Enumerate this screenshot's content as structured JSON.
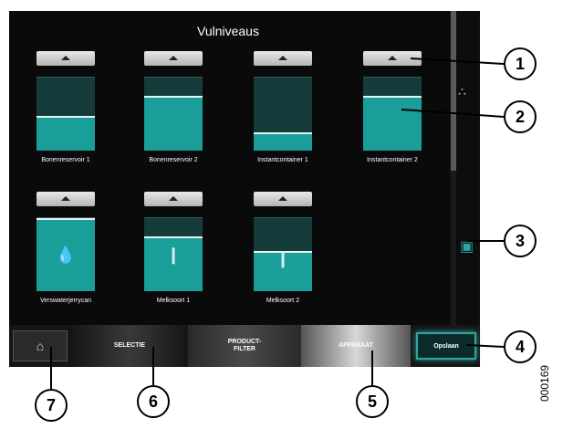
{
  "title": "Vulniveaus",
  "tanks": [
    {
      "label": "Bonenreservoir 1",
      "fill": 0.45
    },
    {
      "label": "Bonenreservoir 2",
      "fill": 0.72
    },
    {
      "label": "Instantcontainer 1",
      "fill": 0.22
    },
    {
      "label": "Instantcontainer 2",
      "fill": 0.72
    },
    {
      "label": "Verswaterjerrycan",
      "fill": 0.98
    },
    {
      "label": "Melksoort 1",
      "fill": 0.72
    },
    {
      "label": "Melksoort 2",
      "fill": 0.53
    }
  ],
  "bottom_nav": {
    "home_icon": "home-icon",
    "tab_selectie": "SELECTIE",
    "tab_productfilter": "PRODUCT-\nFILTER",
    "tab_apparaat": "APPARAAT",
    "save_label": "Opslaan"
  },
  "side_icons": [
    "water-drops-icon",
    "container-icon"
  ],
  "callouts": [
    "1",
    "2",
    "3",
    "4",
    "5",
    "6",
    "7"
  ],
  "figure_code": "000169"
}
